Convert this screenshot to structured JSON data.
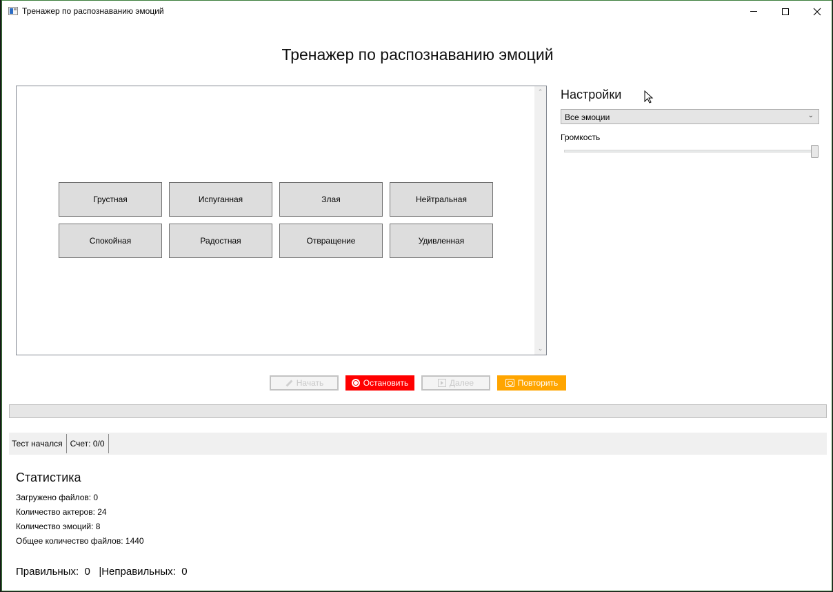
{
  "window": {
    "title": "Тренажер по распознаванию эмоций"
  },
  "main": {
    "heading": "Тренажер по распознаванию эмоций"
  },
  "emotions": [
    "Грустная",
    "Испуганная",
    "Злая",
    "Нейтральная",
    "Спокойная",
    "Радостная",
    "Отвращение",
    "Удивленная"
  ],
  "settings": {
    "title": "Настройки",
    "emotion_filter_value": "Все эмоции",
    "volume_label": "Громкость",
    "volume_level": 1.0
  },
  "controls": {
    "start_label": "Начать",
    "stop_label": "Остановить",
    "next_label": "Далее",
    "repeat_label": "Повторить",
    "colors": {
      "stop": "#ff0000",
      "repeat": "#ffa500"
    }
  },
  "progress": {
    "value": 0
  },
  "status": {
    "state": "Тест начался",
    "score": "Счет: 0/0"
  },
  "statistics": {
    "title": "Статистика",
    "lines": [
      "Загружено файлов: 0",
      "Количество актеров: 24",
      "Количество эмоций: 8",
      "Общее количество файлов: 1440"
    ],
    "correct_label": "Правильных:",
    "correct_value": "0",
    "incorrect_label": "|Неправильных:",
    "incorrect_value": "0"
  }
}
